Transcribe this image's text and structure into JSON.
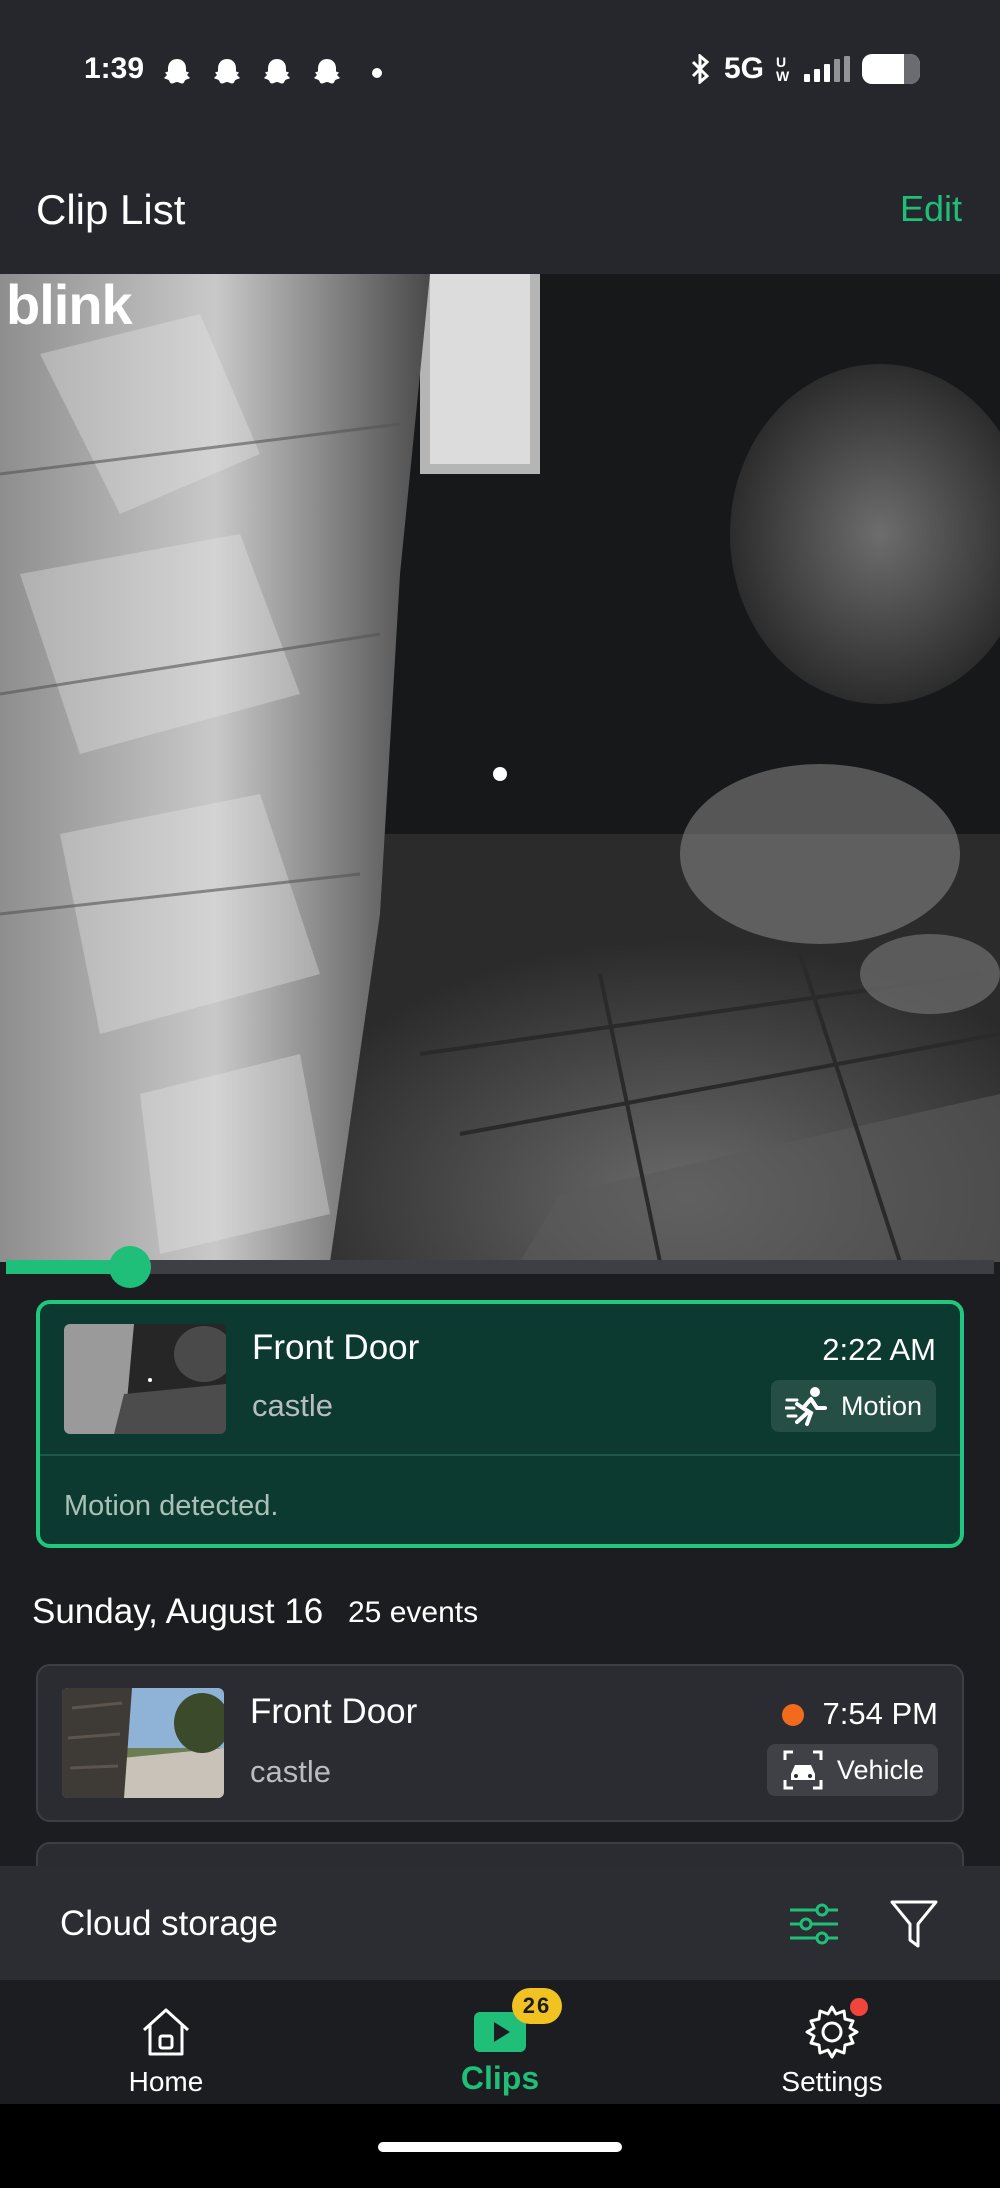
{
  "status_bar": {
    "time": "1:39",
    "network": "5G",
    "network_sub": "UW"
  },
  "header": {
    "title": "Clip List",
    "edit_label": "Edit"
  },
  "video": {
    "logo_text": "blink",
    "progress": 0.125
  },
  "active_clip": {
    "camera": "Front Door",
    "location": "castle",
    "time": "2:22 AM",
    "tag": "Motion",
    "description": "Motion detected."
  },
  "day_group": {
    "date": "Sunday, August 16",
    "event_count": "25 events"
  },
  "clips": [
    {
      "camera": "Front Door",
      "location": "castle",
      "time": "7:54 PM",
      "tag": "Vehicle",
      "unseen": true
    }
  ],
  "cloud_bar": {
    "label": "Cloud storage"
  },
  "tab_bar": {
    "tabs": [
      {
        "label": "Home",
        "icon": "home-icon"
      },
      {
        "label": "Clips",
        "icon": "clips-icon",
        "active": true
      },
      {
        "label": "Settings",
        "icon": "gear-icon"
      }
    ],
    "clips_badge": "26"
  },
  "colors": {
    "accent": "#1fbf79",
    "active_card_bg": "#0d3a30",
    "badge": "#f0c323",
    "unseen_dot": "#f26b1d",
    "notification_dot": "#f0453a"
  }
}
